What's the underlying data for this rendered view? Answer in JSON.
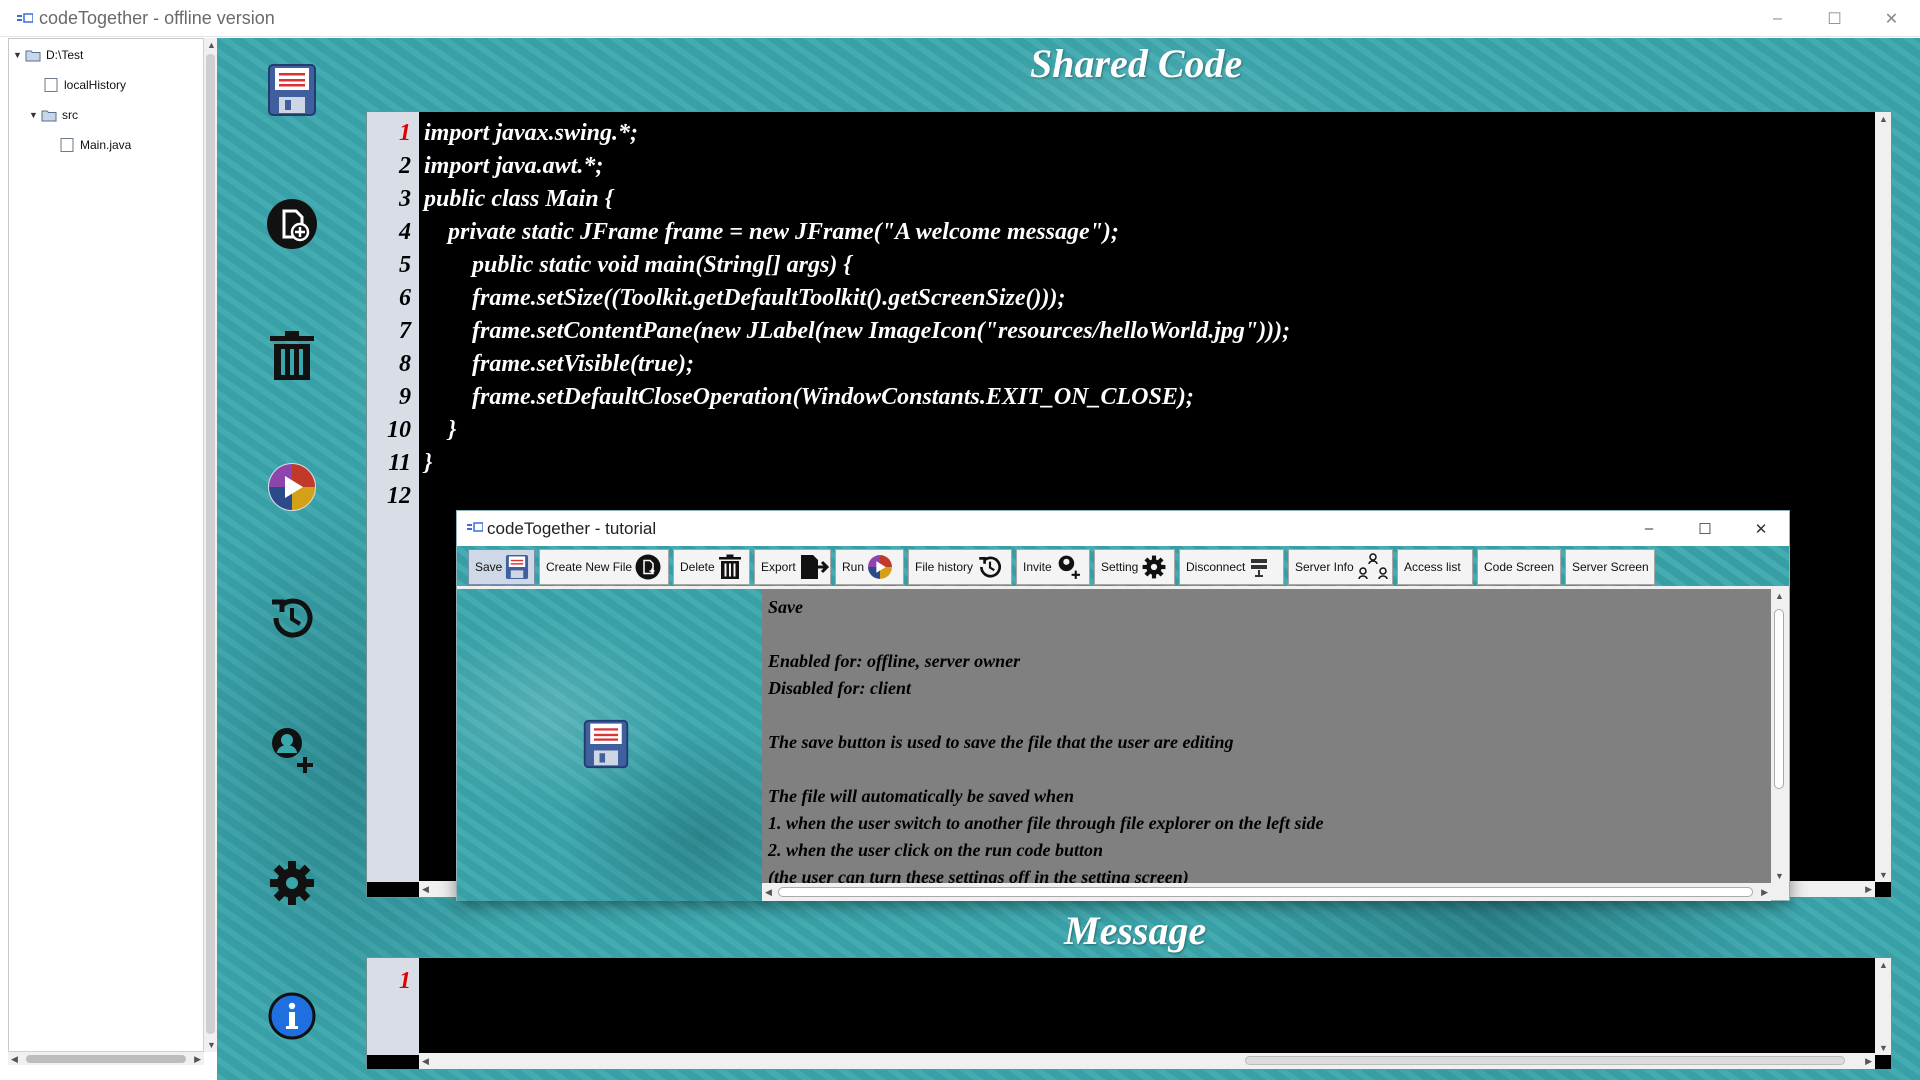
{
  "window": {
    "title": "codeTogether - offline version",
    "controls": {
      "minimize": "–",
      "maximize": "☐",
      "close": "✕"
    }
  },
  "file_tree": {
    "items": [
      {
        "label": "D:\\Test",
        "type": "folder",
        "expanded": true,
        "depth": 0
      },
      {
        "label": "localHistory",
        "type": "file",
        "depth": 1
      },
      {
        "label": "src",
        "type": "folder",
        "expanded": true,
        "depth": 1
      },
      {
        "label": "Main.java",
        "type": "file",
        "depth": 2
      }
    ]
  },
  "side_toolbar": {
    "icons": [
      "save-icon",
      "create-file-icon",
      "delete-icon",
      "run-icon",
      "history-icon",
      "invite-icon",
      "settings-icon",
      "info-icon"
    ]
  },
  "headings": {
    "code": "Shared Code",
    "message": "Message"
  },
  "editor": {
    "current_line": "1",
    "lines": [
      {
        "num": "1",
        "text": "import javax.swing.*;"
      },
      {
        "num": "2",
        "text": "import java.awt.*;"
      },
      {
        "num": "3",
        "text": "public class Main {"
      },
      {
        "num": "4",
        "text": "    private static JFrame frame = new JFrame(\"A welcome message\");"
      },
      {
        "num": "5",
        "text": "        public static void main(String[] args) {"
      },
      {
        "num": "6",
        "text": "        frame.setSize((Toolkit.getDefaultToolkit().getScreenSize()));"
      },
      {
        "num": "7",
        "text": "        frame.setContentPane(new JLabel(new ImageIcon(\"resources/helloWorld.jpg\")));"
      },
      {
        "num": "8",
        "text": "        frame.setVisible(true);"
      },
      {
        "num": "9",
        "text": "        frame.setDefaultCloseOperation(WindowConstants.EXIT_ON_CLOSE);"
      },
      {
        "num": "10",
        "text": "    }"
      },
      {
        "num": "11",
        "text": "}"
      },
      {
        "num": "12",
        "text": ""
      }
    ]
  },
  "message_box": {
    "current_line": "1"
  },
  "tutorial": {
    "title": "codeTogether - tutorial",
    "controls": {
      "minimize": "–",
      "maximize": "☐",
      "close": "✕"
    },
    "toolbar": [
      {
        "label": "Save",
        "icon": "save-icon",
        "active": true
      },
      {
        "label": "Create New File",
        "icon": "create-file-icon"
      },
      {
        "label": "Delete",
        "icon": "delete-icon"
      },
      {
        "label": "Export",
        "icon": "export-icon"
      },
      {
        "label": "Run",
        "icon": "run-icon"
      },
      {
        "label": "File history",
        "icon": "history-icon"
      },
      {
        "label": "Invite",
        "icon": "invite-icon"
      },
      {
        "label": "Setting",
        "icon": "settings-icon"
      },
      {
        "label": "Disconnect",
        "icon": "disconnect-icon"
      },
      {
        "label": "Server Info",
        "icon": "server-info-icon"
      },
      {
        "label": "Access list",
        "icon": ""
      },
      {
        "label": "Code Screen",
        "icon": ""
      },
      {
        "label": "Server Screen",
        "icon": ""
      }
    ],
    "content_lines": [
      "Save",
      "",
      "Enabled for: offline, server owner",
      "Disabled for: client",
      "",
      "The save button is used to save the file that the user are editing",
      "",
      "The file will automatically be saved when",
      "1. when the user switch to another file through file explorer on the left side",
      "2. when the user click on the run code button",
      "(the user can turn these settings off in the setting screen)"
    ]
  },
  "colors": {
    "teal_background": "#3aa7ad",
    "editor_background": "#000000",
    "gutter": "#d9dde6",
    "current_line_number": "#e00000",
    "tutorial_content_bg": "#808080"
  }
}
